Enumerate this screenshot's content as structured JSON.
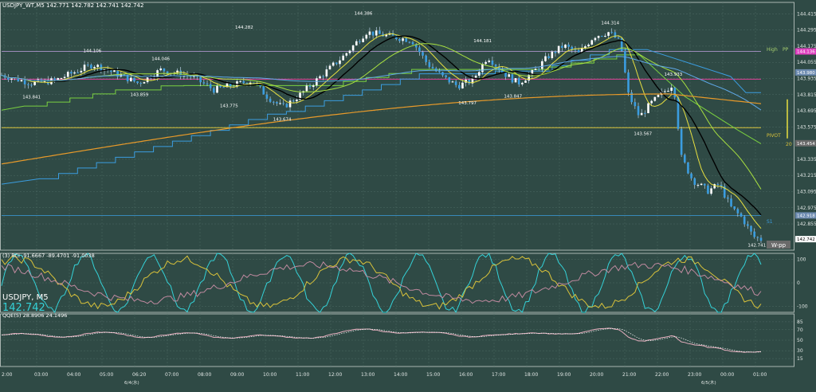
{
  "header": {
    "main_title": "USDJPY_WT,M5  142.771 142.782 142.741 142.742",
    "rci_title": "(3) RCI -91.6667 -89.4701 -91.0038",
    "qqe_title": "QQE(5) 28.8906 24.1496",
    "symbol_label": "USDJPY, M5",
    "symbol_price": "142.742"
  },
  "colors": {
    "background": "#2f4a45",
    "grid": "#4d6a64",
    "candle": "#3b9de0",
    "price_box": "#ffffff",
    "high_label": "#ffffff",
    "pivot": "#d9c23a",
    "vwap_line": "#e0409a",
    "symbol_price": "#34d2d8"
  },
  "right_labels": {
    "high": "High",
    "pp": "PP",
    "pivot": "PIVOT",
    "s1": "S1",
    "wpp": "W-pp",
    "pivot_val": "20"
  },
  "chart_data": {
    "type": "candlestick",
    "ylim": [
      142.66,
      144.5
    ],
    "price_ticks": [
      "144.415",
      "144.295",
      "144.175",
      "144.055",
      "143.935",
      "143.815",
      "143.695",
      "143.575",
      "143.455",
      "143.335",
      "143.215",
      "143.095",
      "142.975",
      "142.855"
    ],
    "price_tag_labels": [
      "144.136",
      "143.980",
      "143.454",
      "142.918",
      "142.742"
    ],
    "time_labels": [
      "2:00",
      "03:00",
      "04:00",
      "05:00",
      "06:20",
      "07:00",
      "08:00",
      "09:00",
      "10:00",
      "11:00",
      "12:00",
      "13:00",
      "14:00",
      "15:00",
      "16:00",
      "17:00",
      "18:00",
      "19:00",
      "20:00",
      "21:00",
      "22:00",
      "23:00",
      "00:00",
      "01:00"
    ],
    "date_labels": [
      "6/4(水)",
      "6/5(木)"
    ],
    "annotations": [
      {
        "label": "144.386",
        "x": 0.475,
        "v": 144.386
      },
      {
        "label": "144.282",
        "x": 0.318,
        "v": 144.282
      },
      {
        "label": "144.106",
        "x": 0.118,
        "v": 144.106
      },
      {
        "label": "144.046",
        "x": 0.208,
        "v": 144.046
      },
      {
        "label": "144.181",
        "x": 0.632,
        "v": 144.181
      },
      {
        "label": "144.314",
        "x": 0.8,
        "v": 144.314
      },
      {
        "label": "143.841",
        "x": 0.038,
        "v": 143.841
      },
      {
        "label": "143.859",
        "x": 0.18,
        "v": 143.859
      },
      {
        "label": "143.775",
        "x": 0.298,
        "v": 143.775
      },
      {
        "label": "143.674",
        "x": 0.368,
        "v": 143.674
      },
      {
        "label": "143.797",
        "x": 0.612,
        "v": 143.797
      },
      {
        "label": "143.847",
        "x": 0.672,
        "v": 143.847
      },
      {
        "label": "143.933",
        "x": 0.883,
        "v": 143.933
      },
      {
        "label": "143.567",
        "x": 0.843,
        "v": 143.567
      },
      {
        "label": "142.741",
        "x": 0.993,
        "v": 142.741
      }
    ],
    "rci_ticks": [
      "100",
      "0",
      "-100"
    ],
    "qqe_ticks": [
      "85",
      "70",
      "50",
      "30",
      "15"
    ]
  }
}
